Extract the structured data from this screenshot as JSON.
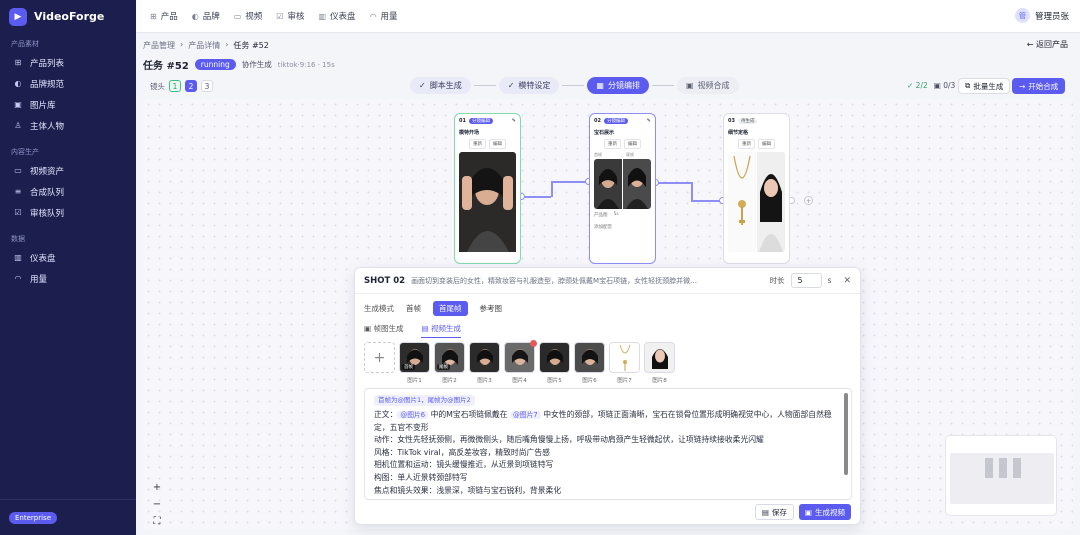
{
  "brand": {
    "name": "VideoForge"
  },
  "sidebar": {
    "sections": [
      {
        "title": "产品素材",
        "items": [
          {
            "label": "产品列表",
            "icon": "box-icon"
          },
          {
            "label": "品牌规范",
            "icon": "palette-icon"
          },
          {
            "label": "图片库",
            "icon": "image-icon"
          },
          {
            "label": "主体人物",
            "icon": "user-icon"
          }
        ]
      },
      {
        "title": "内容生产",
        "items": [
          {
            "label": "视频资产",
            "icon": "video-icon"
          },
          {
            "label": "合成队列",
            "icon": "queue-icon"
          },
          {
            "label": "审核队列",
            "icon": "check-icon"
          }
        ]
      },
      {
        "title": "数据",
        "items": [
          {
            "label": "仪表盘",
            "icon": "chart-icon"
          },
          {
            "label": "用量",
            "icon": "gauge-icon"
          }
        ]
      }
    ],
    "footer_badge": "Enterprise"
  },
  "topnav": [
    {
      "label": "产品",
      "icon": "box-icon"
    },
    {
      "label": "品牌",
      "icon": "palette-icon"
    },
    {
      "label": "视频",
      "icon": "video-icon"
    },
    {
      "label": "审核",
      "icon": "check-icon"
    },
    {
      "label": "仪表盘",
      "icon": "chart-icon"
    },
    {
      "label": "用量",
      "icon": "gauge-icon"
    }
  ],
  "user": {
    "avatar": "管",
    "name": "管理员张"
  },
  "breadcrumb": [
    "产品管理",
    "产品详情",
    "任务 #52"
  ],
  "back_label": "返回产品",
  "task": {
    "title": "任务 #52",
    "status": "running",
    "mode": "协作生成",
    "meta": "tiktok·9:16 · 15s"
  },
  "shots": {
    "label": "镜头",
    "items": [
      "1",
      "2",
      "3"
    ]
  },
  "steps": [
    {
      "label": "脚本生成",
      "state": "done"
    },
    {
      "label": "模特设定",
      "state": "done"
    },
    {
      "label": "分镜编排",
      "state": "active"
    },
    {
      "label": "视频合成",
      "state": "idle"
    }
  ],
  "counts": {
    "done": "2/2",
    "pending": "0/3"
  },
  "actions": {
    "batch": "批量生成",
    "start": "开始合成"
  },
  "cards": [
    {
      "num": "01",
      "tag": "分镜编辑",
      "title": "模特开场",
      "btn1": "重新",
      "btn2": "编辑"
    },
    {
      "num": "02",
      "tag": "分镜编辑",
      "title": "宝石展示",
      "btn1": "重新",
      "btn2": "编辑",
      "sub1": "首帧",
      "sub2": "尾帧",
      "foot1": "产品图",
      "foot2": "5s",
      "foot3": "添加配音"
    },
    {
      "num": "03",
      "tag": "待生成",
      "title": "细节定格",
      "btn1": "重新",
      "btn2": "编辑"
    }
  ],
  "panel": {
    "title": "SHOT 02",
    "description": "画面切到变装后的女性，精致妆容与礼服造型，脖颈处佩戴M宝石项链，女性轻抚颈脖并微…",
    "duration_label": "时长",
    "duration_value": "5",
    "duration_unit": "s",
    "mode_label": "生成模式",
    "modes": [
      "首帧",
      "首尾帧",
      "参考图"
    ],
    "subtabs": [
      "帧图生成",
      "视频生成"
    ],
    "thumbs": [
      "图片1",
      "图片2",
      "图片3",
      "图片4",
      "图片5",
      "图片6",
      "图片7",
      "图片8"
    ],
    "thumb_badges": {
      "first": "首帧",
      "last": "尾帧"
    },
    "chip_line": "首帧为@图片1，尾帧为@图片2",
    "prompt": {
      "lead": "正文：",
      "chip1": "@图片6",
      "mid": "中的M宝石项链佩戴在",
      "chip2": "@图片7",
      "rest": "中女性的颈部，项链正面清晰，宝石在锁骨位置形成明确视觉中心，人物面部自然稳定，五官不变形",
      "lines": [
        "动作：女性先轻抚颈侧，再微微侧头，随后嘴角慢慢上扬，呼吸带动肩颈产生轻微起伏，让项链持续接收柔光闪耀",
        "风格：TikTok viral，高反差妆容，精致时尚广告感",
        "相机位置和运动：镜头缓慢推近，从近景到项链特写",
        "构图：单人近景转颈部特写",
        "焦点和镜头效果：浅景深，项链与宝石锐利，背景柔化"
      ]
    },
    "save": "保存",
    "generate": "生成视频"
  },
  "zoom": {
    "in": "+",
    "out": "−",
    "fit": "⛶"
  },
  "colors": {
    "sidebar": "#1c1f4d",
    "accent": "#5b5bf0",
    "success": "#3fbf84"
  }
}
